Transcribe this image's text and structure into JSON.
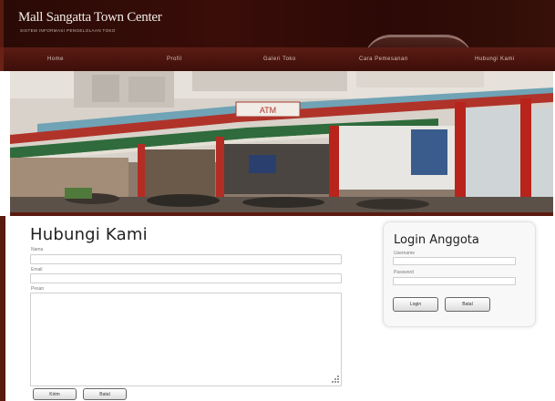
{
  "header": {
    "title": "Mall Sangatta Town Center",
    "subtitle": "SISTEM INFORMASI PENGELOLAAN TOKO"
  },
  "nav": {
    "items": [
      "Home",
      "Profil",
      "Galeri Toko",
      "Cara Pemesanan",
      "Hubungi Kami"
    ]
  },
  "banner": {
    "sign_text": "ATM"
  },
  "contact": {
    "title": "Hubungi Kami",
    "name_label": "Nama",
    "email_label": "Email",
    "message_label": "Pesan",
    "name_value": "",
    "email_value": "",
    "message_value": "",
    "send_button": "Kirim",
    "reset_button": "Batal"
  },
  "login": {
    "title": "Login Anggota",
    "username_label": "Username",
    "password_label": "Password",
    "username_value": "",
    "password_value": "",
    "login_button": "Login",
    "reset_button": "Batal"
  },
  "colors": {
    "header_bg": "#2a0a06",
    "nav_bg": "#4a140d",
    "frame_accent": "#5a1a10"
  }
}
